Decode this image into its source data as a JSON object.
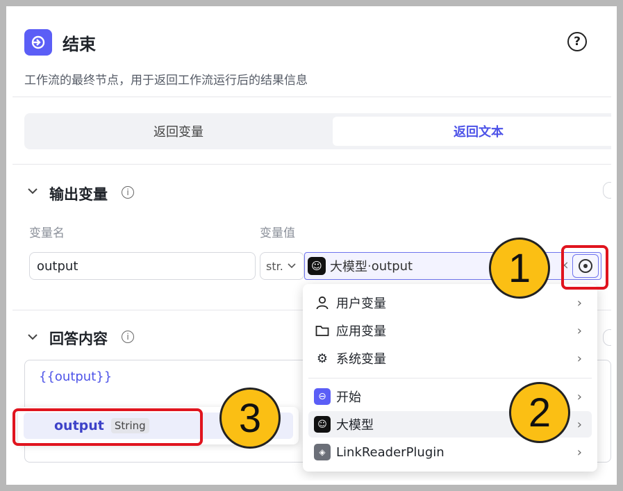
{
  "header": {
    "title": "结束",
    "description": "工作流的最终节点，用于返回工作流运行后的结果信息",
    "help_icon": "?"
  },
  "tabs": [
    {
      "label": "返回变量",
      "active": false
    },
    {
      "label": "返回文本",
      "active": true
    }
  ],
  "output_section": {
    "title": "输出变量",
    "col_name_label": "变量名",
    "col_value_label": "变量值",
    "row": {
      "name": "output",
      "type": "str.",
      "value_node": "大模型",
      "value_separator": " · ",
      "value_field": "output",
      "clear": "×"
    }
  },
  "answer_section": {
    "title": "回答内容",
    "content": "{{output}}"
  },
  "suggestion": {
    "name": "output",
    "type": "String"
  },
  "dropdown": {
    "items": [
      {
        "label": "用户变量",
        "icon": "user-icon"
      },
      {
        "label": "应用变量",
        "icon": "folder-icon"
      },
      {
        "label": "系统变量",
        "icon": "gear-icon"
      },
      {
        "label": "开始",
        "icon": "start-node-icon"
      },
      {
        "label": "大模型",
        "icon": "llm-node-icon"
      },
      {
        "label": "LinkReaderPlugin",
        "icon": "plugin-icon"
      }
    ]
  },
  "annotations": {
    "badge1": "1",
    "badge2": "2",
    "badge3": "3",
    "color": "#e0141e",
    "badge_color": "#fbbf14"
  },
  "colors": {
    "accent": "#4d53e8",
    "node_icon": "#5b5ef6"
  }
}
